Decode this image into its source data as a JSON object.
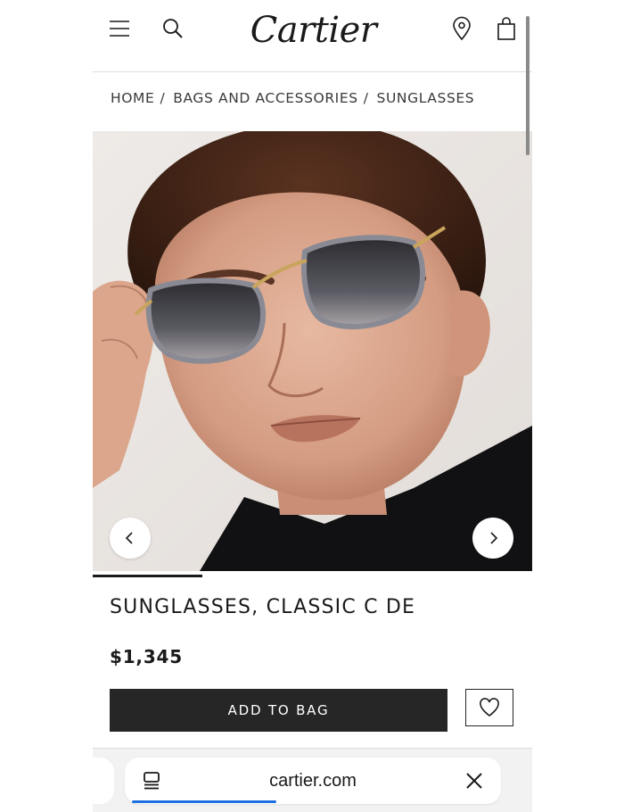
{
  "header": {
    "logo": "Cartier",
    "icons": [
      "menu-icon",
      "search-icon",
      "location-pin-icon",
      "shopping-bag-icon"
    ]
  },
  "breadcrumb": {
    "items": [
      "HOME",
      "BAGS AND ACCESSORIES",
      "SUNGLASSES"
    ],
    "separator": "/"
  },
  "carousel": {
    "image": "model-wearing-sunglasses",
    "prev_icon": "chevron-left-icon",
    "next_icon": "chevron-right-icon",
    "progress": 0.25
  },
  "product": {
    "title": "SUNGLASSES, CLASSIC C DE",
    "price": "$1,345",
    "add_to_bag_label": "ADD TO BAG",
    "wishlist_icon": "heart-icon"
  },
  "browser": {
    "url": "cartier.com",
    "tabs_icon": "tabs-icon",
    "close_icon": "close-icon",
    "accent": "#1f6fe0"
  },
  "colors": {
    "primary": "#262626",
    "text": "#1a1a1a",
    "background": "#ffffff"
  }
}
